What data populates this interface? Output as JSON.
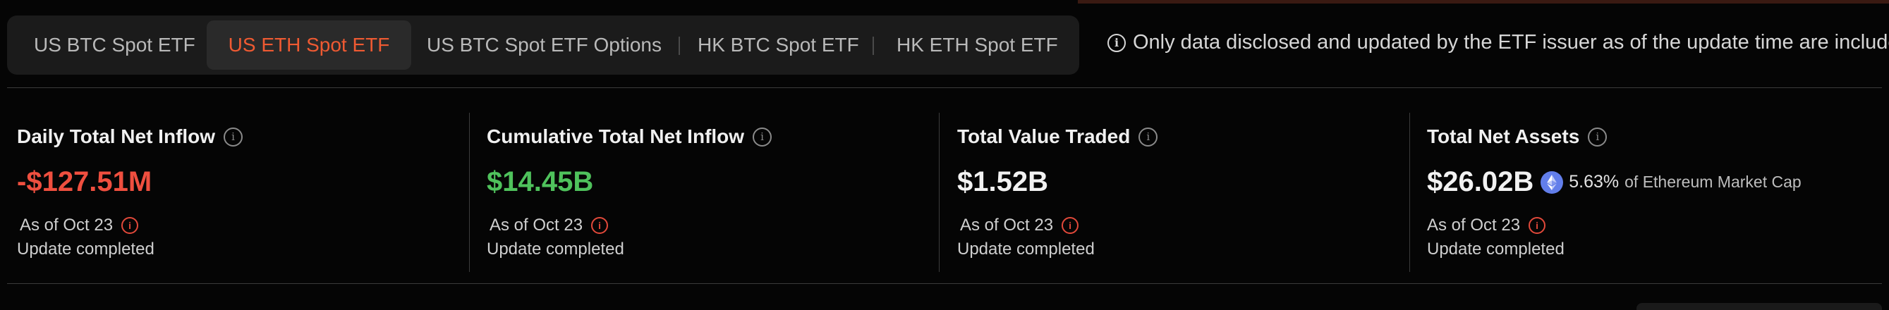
{
  "tabs": [
    {
      "label": "US BTC Spot ETF",
      "active": false
    },
    {
      "label": "US ETH Spot ETF",
      "active": true
    },
    {
      "label": "US BTC Spot ETF Options",
      "active": false
    },
    {
      "label": "HK BTC Spot ETF",
      "active": false
    },
    {
      "label": "HK ETH Spot ETF",
      "active": false
    }
  ],
  "notice": {
    "icon": "info-icon",
    "text": "Only data disclosed and updated by the ETF issuer as of the update time are included."
  },
  "cards": [
    {
      "title": "Daily Total Net Inflow",
      "value": "-$127.51M",
      "value_color": "#ef4f3f",
      "as_of": "As of Oct 23",
      "status": "Update completed"
    },
    {
      "title": "Cumulative Total Net Inflow",
      "value": "$14.45B",
      "value_color": "#4fc25c",
      "as_of": "As of Oct 23",
      "status": "Update completed"
    },
    {
      "title": "Total Value Traded",
      "value": "$1.52B",
      "value_color": "#f2f2f2",
      "as_of": "As of Oct 23",
      "status": "Update completed"
    },
    {
      "title": "Total Net Assets",
      "value": "$26.02B",
      "value_color": "#f2f2f2",
      "market_cap_pct": "5.63%",
      "market_cap_label": "of Ethereum Market Cap",
      "as_of": "As of Oct 23",
      "status": "Update completed"
    }
  ],
  "colors": {
    "accent": "#ef5a32",
    "negative": "#ef4f3f",
    "positive": "#4fc25c",
    "warning_icon": "#e2493a",
    "eth_icon": "#627eea"
  }
}
